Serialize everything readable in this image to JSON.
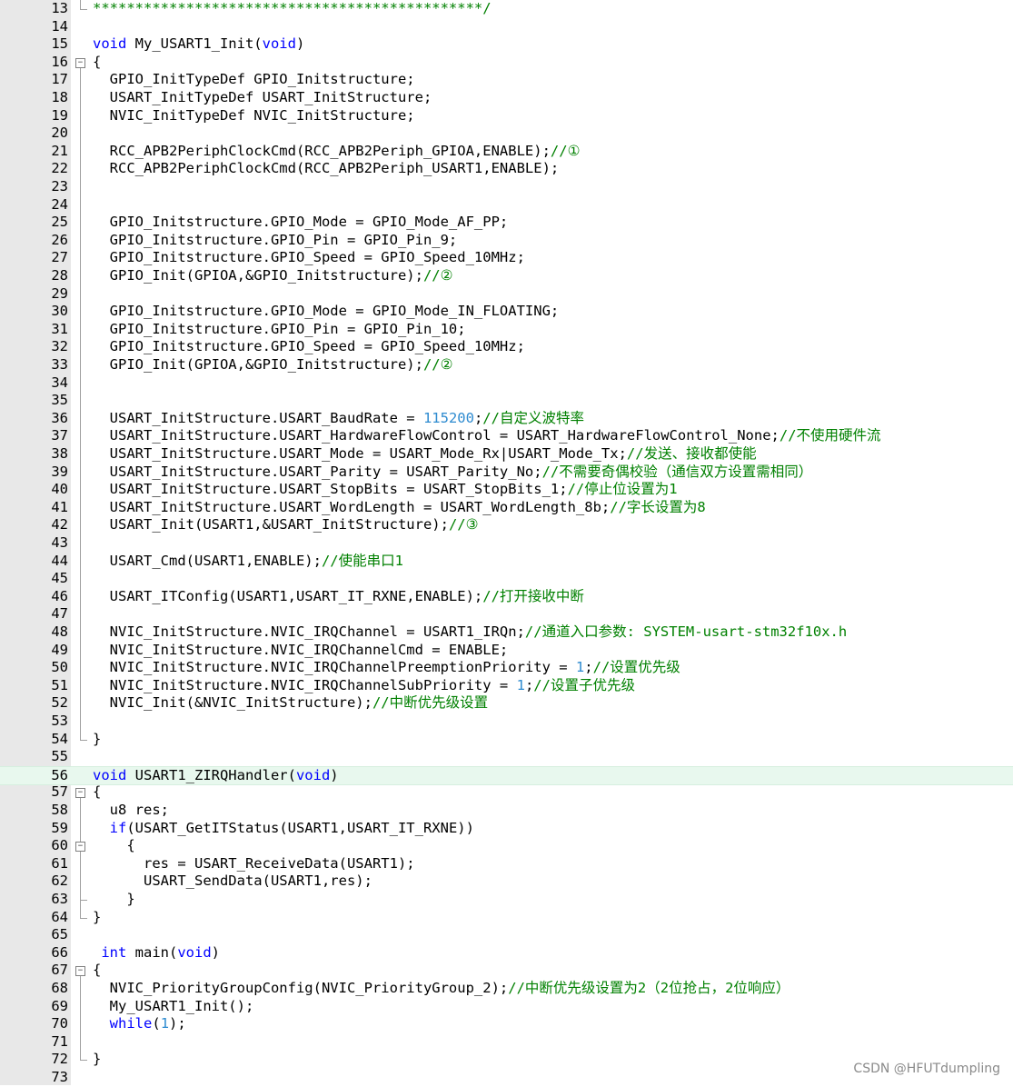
{
  "editor": {
    "lines": [
      {
        "n": "13",
        "t": "",
        "s": [
          {
            "c": "star",
            "v": "**********************************************/"
          }
        ]
      },
      {
        "n": "14",
        "s": []
      },
      {
        "n": "15",
        "s": [
          {
            "c": "kw",
            "v": "void"
          },
          {
            "c": "",
            "v": " My_USART1_Init("
          },
          {
            "c": "kw",
            "v": "void"
          },
          {
            "c": "",
            "v": ")"
          }
        ]
      },
      {
        "n": "16",
        "s": [
          {
            "c": "",
            "v": "{"
          }
        ]
      },
      {
        "n": "17",
        "s": [
          {
            "c": "",
            "v": "  GPIO_InitTypeDef GPIO_Initstructure;"
          }
        ]
      },
      {
        "n": "18",
        "s": [
          {
            "c": "",
            "v": "  USART_InitTypeDef USART_InitStructure;"
          }
        ]
      },
      {
        "n": "19",
        "s": [
          {
            "c": "",
            "v": "  NVIC_InitTypeDef NVIC_InitStructure;"
          }
        ]
      },
      {
        "n": "20",
        "s": []
      },
      {
        "n": "21",
        "s": [
          {
            "c": "",
            "v": "  RCC_APB2PeriphClockCmd(RCC_APB2Periph_GPIOA,ENABLE);"
          },
          {
            "c": "cm",
            "v": "//①"
          }
        ]
      },
      {
        "n": "22",
        "s": [
          {
            "c": "",
            "v": "  RCC_APB2PeriphClockCmd(RCC_APB2Periph_USART1,ENABLE);"
          }
        ]
      },
      {
        "n": "23",
        "s": []
      },
      {
        "n": "24",
        "s": []
      },
      {
        "n": "25",
        "s": [
          {
            "c": "",
            "v": "  GPIO_Initstructure.GPIO_Mode = GPIO_Mode_AF_PP;"
          }
        ]
      },
      {
        "n": "26",
        "s": [
          {
            "c": "",
            "v": "  GPIO_Initstructure.GPIO_Pin = GPIO_Pin_9;"
          }
        ]
      },
      {
        "n": "27",
        "s": [
          {
            "c": "",
            "v": "  GPIO_Initstructure.GPIO_Speed = GPIO_Speed_10MHz;"
          }
        ]
      },
      {
        "n": "28",
        "s": [
          {
            "c": "",
            "v": "  GPIO_Init(GPIOA,&GPIO_Initstructure);"
          },
          {
            "c": "cm",
            "v": "//②"
          }
        ]
      },
      {
        "n": "29",
        "s": []
      },
      {
        "n": "30",
        "s": [
          {
            "c": "",
            "v": "  GPIO_Initstructure.GPIO_Mode = GPIO_Mode_IN_FLOATING;"
          }
        ]
      },
      {
        "n": "31",
        "s": [
          {
            "c": "",
            "v": "  GPIO_Initstructure.GPIO_Pin = GPIO_Pin_10;"
          }
        ]
      },
      {
        "n": "32",
        "s": [
          {
            "c": "",
            "v": "  GPIO_Initstructure.GPIO_Speed = GPIO_Speed_10MHz;"
          }
        ]
      },
      {
        "n": "33",
        "s": [
          {
            "c": "",
            "v": "  GPIO_Init(GPIOA,&GPIO_Initstructure);"
          },
          {
            "c": "cm",
            "v": "//②"
          }
        ]
      },
      {
        "n": "34",
        "s": []
      },
      {
        "n": "35",
        "s": []
      },
      {
        "n": "36",
        "s": [
          {
            "c": "",
            "v": "  USART_InitStructure.USART_BaudRate = "
          },
          {
            "c": "num",
            "v": "115200"
          },
          {
            "c": "",
            "v": ";"
          },
          {
            "c": "cm",
            "v": "//自定义波特率"
          }
        ]
      },
      {
        "n": "37",
        "s": [
          {
            "c": "",
            "v": "  USART_InitStructure.USART_HardwareFlowControl = USART_HardwareFlowControl_None;"
          },
          {
            "c": "cm",
            "v": "//不使用硬件流"
          }
        ]
      },
      {
        "n": "38",
        "s": [
          {
            "c": "",
            "v": "  USART_InitStructure.USART_Mode = USART_Mode_Rx|USART_Mode_Tx;"
          },
          {
            "c": "cm",
            "v": "//发送、接收都使能"
          }
        ]
      },
      {
        "n": "39",
        "s": [
          {
            "c": "",
            "v": "  USART_InitStructure.USART_Parity = USART_Parity_No;"
          },
          {
            "c": "cm",
            "v": "//不需要奇偶校验（通信双方设置需相同）"
          }
        ]
      },
      {
        "n": "40",
        "s": [
          {
            "c": "",
            "v": "  USART_InitStructure.USART_StopBits = USART_StopBits_1;"
          },
          {
            "c": "cm",
            "v": "//停止位设置为1"
          }
        ]
      },
      {
        "n": "41",
        "s": [
          {
            "c": "",
            "v": "  USART_InitStructure.USART_WordLength = USART_WordLength_8b;"
          },
          {
            "c": "cm",
            "v": "//字长设置为8"
          }
        ]
      },
      {
        "n": "42",
        "s": [
          {
            "c": "",
            "v": "  USART_Init(USART1,&USART_InitStructure);"
          },
          {
            "c": "cm",
            "v": "//③"
          }
        ]
      },
      {
        "n": "43",
        "s": []
      },
      {
        "n": "44",
        "s": [
          {
            "c": "",
            "v": "  USART_Cmd(USART1,ENABLE);"
          },
          {
            "c": "cm",
            "v": "//使能串口1"
          }
        ]
      },
      {
        "n": "45",
        "s": []
      },
      {
        "n": "46",
        "s": [
          {
            "c": "",
            "v": "  USART_ITConfig(USART1,USART_IT_RXNE,ENABLE);"
          },
          {
            "c": "cm",
            "v": "//打开接收中断"
          }
        ]
      },
      {
        "n": "47",
        "s": []
      },
      {
        "n": "48",
        "s": [
          {
            "c": "",
            "v": "  NVIC_InitStructure.NVIC_IRQChannel = USART1_IRQn;"
          },
          {
            "c": "cm",
            "v": "//通道入口参数: SYSTEM-usart-stm32f10x.h"
          }
        ]
      },
      {
        "n": "49",
        "s": [
          {
            "c": "",
            "v": "  NVIC_InitStructure.NVIC_IRQChannelCmd = ENABLE;"
          }
        ]
      },
      {
        "n": "50",
        "s": [
          {
            "c": "",
            "v": "  NVIC_InitStructure.NVIC_IRQChannelPreemptionPriority = "
          },
          {
            "c": "num",
            "v": "1"
          },
          {
            "c": "",
            "v": ";"
          },
          {
            "c": "cm",
            "v": "//设置优先级"
          }
        ]
      },
      {
        "n": "51",
        "s": [
          {
            "c": "",
            "v": "  NVIC_InitStructure.NVIC_IRQChannelSubPriority = "
          },
          {
            "c": "num",
            "v": "1"
          },
          {
            "c": "",
            "v": ";"
          },
          {
            "c": "cm",
            "v": "//设置子优先级"
          }
        ]
      },
      {
        "n": "52",
        "s": [
          {
            "c": "",
            "v": "  NVIC_Init(&NVIC_InitStructure);"
          },
          {
            "c": "cm",
            "v": "//中断优先级设置"
          }
        ]
      },
      {
        "n": "53",
        "s": []
      },
      {
        "n": "54",
        "s": [
          {
            "c": "",
            "v": "}"
          }
        ]
      },
      {
        "n": "55",
        "s": []
      },
      {
        "n": "56",
        "s": [
          {
            "c": "kw",
            "v": "void"
          },
          {
            "c": "",
            "v": " USART1_ZIRQHandler("
          },
          {
            "c": "kw",
            "v": "void"
          },
          {
            "c": "",
            "v": ")"
          }
        ]
      },
      {
        "n": "57",
        "s": [
          {
            "c": "",
            "v": "{"
          }
        ]
      },
      {
        "n": "58",
        "s": [
          {
            "c": "",
            "v": "  u8 res;"
          }
        ]
      },
      {
        "n": "59",
        "s": [
          {
            "c": "",
            "v": "  "
          },
          {
            "c": "kw",
            "v": "if"
          },
          {
            "c": "",
            "v": "(USART_GetITStatus(USART1,USART_IT_RXNE))"
          }
        ]
      },
      {
        "n": "60",
        "s": [
          {
            "c": "",
            "v": "    {"
          }
        ]
      },
      {
        "n": "61",
        "s": [
          {
            "c": "",
            "v": "      res = USART_ReceiveData(USART1);"
          }
        ]
      },
      {
        "n": "62",
        "s": [
          {
            "c": "",
            "v": "      USART_SendData(USART1,res);"
          }
        ]
      },
      {
        "n": "63",
        "s": [
          {
            "c": "",
            "v": "    }"
          }
        ]
      },
      {
        "n": "64",
        "s": [
          {
            "c": "",
            "v": "}"
          }
        ]
      },
      {
        "n": "65",
        "s": []
      },
      {
        "n": "66",
        "s": [
          {
            "c": "",
            "v": " "
          },
          {
            "c": "kw",
            "v": "int"
          },
          {
            "c": "",
            "v": " main("
          },
          {
            "c": "kw",
            "v": "void"
          },
          {
            "c": "",
            "v": ")"
          }
        ]
      },
      {
        "n": "67",
        "s": [
          {
            "c": "",
            "v": "{"
          }
        ]
      },
      {
        "n": "68",
        "s": [
          {
            "c": "",
            "v": "  NVIC_PriorityGroupConfig(NVIC_PriorityGroup_2);"
          },
          {
            "c": "cm",
            "v": "//中断优先级设置为2（2位抢占，2位响应）"
          }
        ]
      },
      {
        "n": "69",
        "s": [
          {
            "c": "",
            "v": "  My_USART1_Init();"
          }
        ]
      },
      {
        "n": "70",
        "s": [
          {
            "c": "",
            "v": "  "
          },
          {
            "c": "kw",
            "v": "while"
          },
          {
            "c": "",
            "v": "("
          },
          {
            "c": "num",
            "v": "1"
          },
          {
            "c": "",
            "v": ");"
          }
        ]
      },
      {
        "n": "71",
        "s": []
      },
      {
        "n": "72",
        "s": [
          {
            "c": "",
            "v": "}"
          }
        ]
      },
      {
        "n": "73",
        "s": []
      }
    ],
    "current_line": "56",
    "fold_markers": [
      "16",
      "57",
      "60",
      "67"
    ],
    "colors": {
      "keyword": "#0000ff",
      "number": "#2e8bd0",
      "comment": "#008000",
      "gutter": "#e8e8e8",
      "current_line": "#e8f8ee"
    }
  },
  "watermark": "CSDN @HFUTdumpling"
}
